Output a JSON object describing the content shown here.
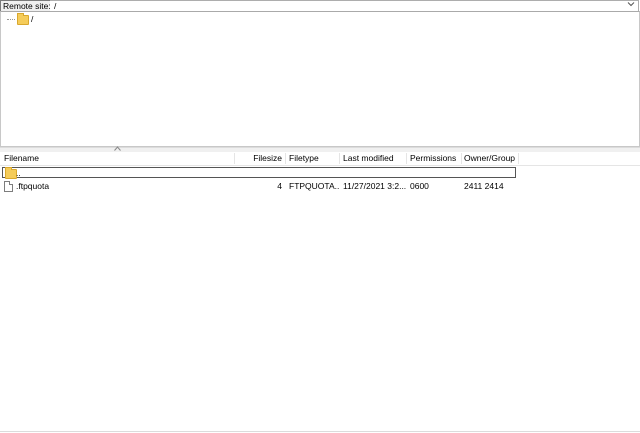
{
  "address": {
    "label": "Remote site:",
    "value": "/",
    "dropdown_icon": "chevron-down-icon"
  },
  "tree": {
    "root_label": "/",
    "folder_icon": "folder-icon"
  },
  "columns": {
    "filename": "Filename",
    "filesize": "Filesize",
    "filetype": "Filetype",
    "last_modified": "Last modified",
    "permissions": "Permissions",
    "owner_group": "Owner/Group"
  },
  "rows": [
    {
      "filename": "..",
      "icon": "folder-icon",
      "filesize": "",
      "filetype": "",
      "last_modified": "",
      "permissions": "",
      "owner_group": ""
    },
    {
      "filename": ".ftpquota",
      "icon": "file-icon",
      "filesize": "4",
      "filetype": "FTPQUOTA...",
      "last_modified": "11/27/2021 3:2...",
      "permissions": "0600",
      "owner_group": "2411 2414"
    }
  ],
  "colors": {
    "folder": "#f5cc5a",
    "border": "#c8c8c8"
  }
}
